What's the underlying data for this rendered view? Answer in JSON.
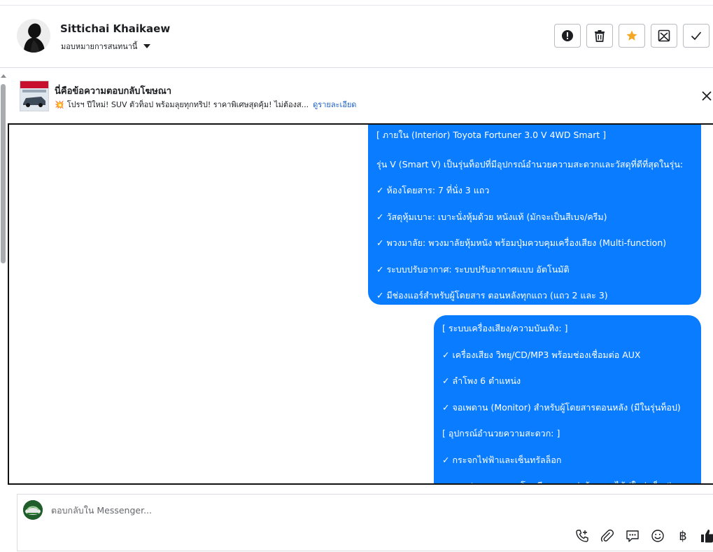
{
  "header": {
    "contact_name": "Sittichai Khaikaew",
    "assign_label": "มอบหมายการสนทนานี้",
    "actions": [
      "report-icon",
      "trash-icon",
      "star-icon",
      "mark-unread-icon",
      "done-icon"
    ]
  },
  "ad_reply": {
    "title": "นี่คือข้อความตอบกลับโฆษณา",
    "emoji": "💥",
    "snippet": "โปรฯ ปีใหม่! SUV ตัวท็อป พร้อมลุยทุกทริป! ราคาพิเศษสุดคุ้ม! ไม่ต้องส...",
    "details_link": "ดูรายละเอียด"
  },
  "messages": {
    "bubble1": [
      "[ ภายใน (Interior) Toyota Fortuner 3.0 V 4WD Smart ]",
      "รุ่น V (Smart V) เป็นรุ่นท็อปที่มีอุปกรณ์อำนวยความสะดวกและวัสดุที่ดีที่สุดในรุ่น:",
      "✓ ห้องโดยสาร: 7 ที่นั่ง 3 แถว",
      "✓ วัสดุหุ้มเบาะ: เบาะนั่งหุ้มด้วย หนังแท้ (มักจะเป็นสีเบจ/ครีม)",
      "✓ พวงมาลัย: พวงมาลัยหุ้มหนัง พร้อมปุ่มควบคุมเครื่องเสียง (Multi-function)",
      "✓ ระบบปรับอากาศ: ระบบปรับอากาศแบบ อัตโนมัติ",
      "✓ มีช่องแอร์สำหรับผู้โดยสาร ตอนหลังทุกแถว (แถว 2 และ 3)"
    ],
    "bubble2": [
      "[ ระบบเครื่องเสียง/ความบันเทิง: ]",
      "✓ เครื่องเสียง วิทยุ/CD/MP3 พร้อมช่องเชื่อมต่อ AUX",
      "✓ ลำโพง 6 ตำแหน่ง",
      "✓ จอเพดาน (Monitor) สำหรับผู้โดยสารตอนหลัง (มีในรุ่นท็อป)",
      "[ อุปกรณ์อำนวยความสะดวก: ]",
      "✓ กระจกไฟฟ้าและเซ็นทรัลล็อก",
      "✓ แผงประตูและคอนโซลมีการตกแต่งด้วยลายไม้ (ในรุ่นท็อป)"
    ]
  },
  "composer": {
    "placeholder": "ตอบกลับใน Messenger...",
    "tools": [
      "call-icon",
      "attach-icon",
      "saved-reply-icon",
      "emoji-icon",
      "baht-icon",
      "like-icon"
    ],
    "baht_symbol": "฿"
  },
  "colors": {
    "bubble": "#0a7cff",
    "star": "#f5a623",
    "link": "#1a60c9"
  }
}
